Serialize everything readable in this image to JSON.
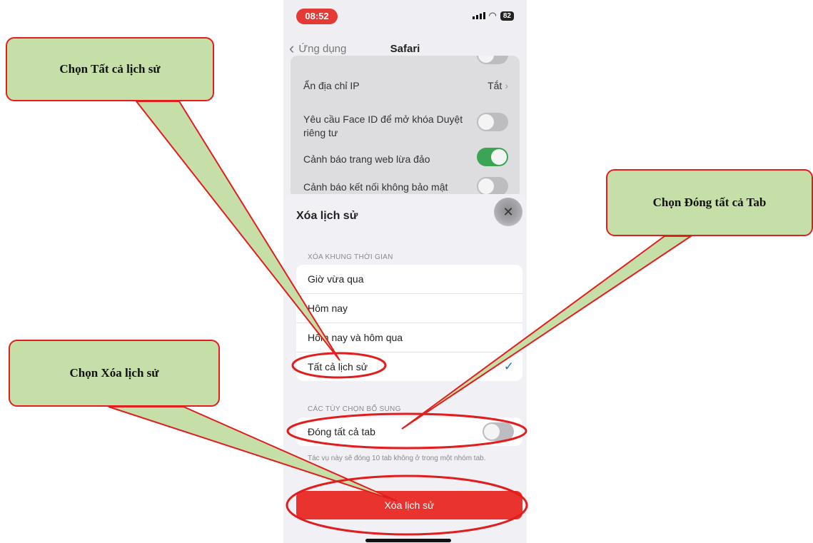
{
  "status_bar": {
    "time": "08:52",
    "battery": "82"
  },
  "nav": {
    "back_label": "Ứng dụng",
    "title": "Safari"
  },
  "settings": {
    "hide_ip": {
      "label": "Ẩn địa chỉ IP",
      "value": "Tắt"
    },
    "faceid": {
      "label": "Yêu cầu Face ID để mở khóa Duyệt riêng tư",
      "enabled": false
    },
    "fraud_warning": {
      "label": "Cảnh báo trang web lừa đảo",
      "enabled": true
    },
    "insecure_warning": {
      "label": "Cảnh báo kết nối không bảo mật",
      "enabled": false
    }
  },
  "sheet": {
    "title": "Xóa lịch sử",
    "time_range_header": "XÓA KHUNG THỜI GIAN",
    "time_ranges": [
      "Giờ vừa qua",
      "Hôm nay",
      "Hôm nay và hôm qua",
      "Tất cả lịch sử"
    ],
    "selected_range": "Tất cả lịch sử",
    "options_header": "CÁC TÙY CHỌN BỔ SUNG",
    "close_tabs": {
      "label": "Đóng tất cả tab",
      "enabled": false
    },
    "footnote": "Tác vụ này sẽ đóng 10 tab không ở trong một nhóm tab.",
    "delete_button": "Xóa lịch sử"
  },
  "callouts": {
    "all_history": "Chọn Tất cả lịch sử",
    "close_all_tabs": "Chọn Đóng tất cả Tab",
    "delete_history": "Chọn Xóa lịch sử"
  },
  "colors": {
    "annotation_red": "#e11d1d",
    "callout_fill": "#c6dfa9",
    "toggle_on": "#3aa655",
    "delete_red": "#e8332f"
  }
}
